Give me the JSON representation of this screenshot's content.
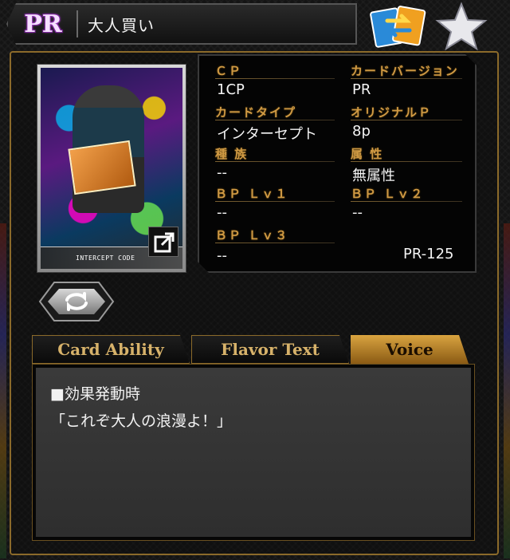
{
  "header": {
    "rarity": "PR",
    "card_name": "大人買い"
  },
  "card_image": {
    "code_label": "INTERCEPT CODE"
  },
  "info": {
    "cp_label": "ＣＰ",
    "cp_value": "1CP",
    "version_label": "カードバージョン",
    "version_value": "PR",
    "type_label": "カードタイプ",
    "type_value": "インターセプト",
    "original_p_label": "オリジナルＰ",
    "original_p_value": "8p",
    "race_label": "種 族",
    "race_value": "--",
    "attribute_label": "属 性",
    "attribute_value": "無属性",
    "bp1_label": "ＢＰ Ｌｖ１",
    "bp1_value": "--",
    "bp2_label": "ＢＰ Ｌｖ２",
    "bp2_value": "--",
    "bp3_label": "ＢＰ Ｌｖ３",
    "bp3_value": "--",
    "card_number": "PR-125"
  },
  "tabs": [
    {
      "label": "Card Ability",
      "active": false
    },
    {
      "label": "Flavor Text",
      "active": false
    },
    {
      "label": "Voice",
      "active": true
    }
  ],
  "voice_text": {
    "line1": "■効果発動時",
    "line2": "「これぞ大人の浪漫よ！」"
  },
  "colors": {
    "gold": "#d09a44",
    "tab_active": "#d9a440",
    "swap_blue": "#2a8ad8",
    "swap_orange": "#f0a020"
  },
  "icons": {
    "swap": "swap-cards-icon",
    "favorite": "star-icon",
    "rotate": "rotate-icon",
    "expand": "expand-icon"
  }
}
